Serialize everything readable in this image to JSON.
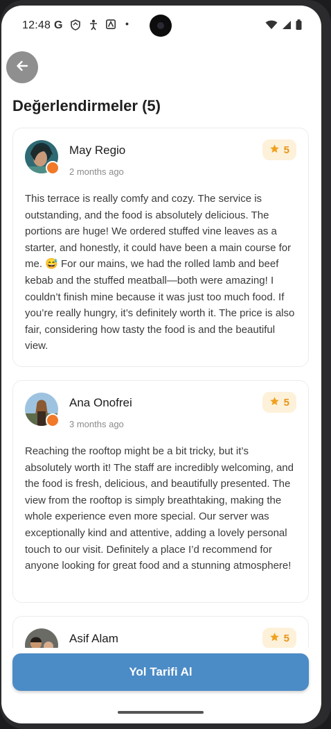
{
  "status_bar": {
    "time": "12:48"
  },
  "page": {
    "title": "Değerlendirmeler (5)"
  },
  "reviews": [
    {
      "name": "May Regio",
      "time": "2 months ago",
      "rating": "5",
      "text": "This terrace is really comfy and cozy. The service is outstanding, and the food is absolutely delicious. The portions are huge! We ordered stuffed vine leaves as a starter, and honestly, it could have been a main course for me. 😅 For our mains, we had the rolled lamb and beef kebab and the stuffed meatball—both were amazing! I couldn’t finish mine because it was just too much food. If you’re really hungry, it’s definitely worth it. The price is also fair, considering how tasty the food is and the beautiful view."
    },
    {
      "name": "Ana Onofrei",
      "time": "3 months ago",
      "rating": "5",
      "text": "Reaching the rooftop might be a bit tricky, but it’s absolutely worth it! The staff are incredibly welcoming, and the food is fresh, delicious, and beautifully presented. The view from the rooftop is simply breathtaking, making the whole experience even more special. Our server was exceptionally kind and attentive, adding a lovely personal touch to our visit. Definitely a place I’d recommend for anyone looking for great food and a stunning atmosphere!"
    },
    {
      "name": "Asif Alam",
      "rating": "5"
    }
  ],
  "cta": {
    "label": "Yol Tarifi Al"
  },
  "colors": {
    "accent": "#4b8bc6",
    "star": "#f0a020",
    "rating_bg": "#fdf1d9"
  }
}
